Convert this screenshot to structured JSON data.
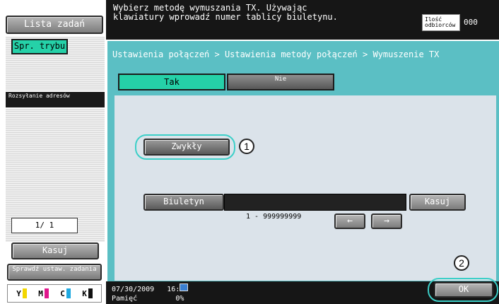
{
  "sidebar": {
    "job_list_label": "Lista zadań",
    "check_mode_label": "Spr. trybu",
    "address_broadcast_label": "Rozsyłanie adresów",
    "page_indicator": "1/ 1",
    "delete_label": "Kasuj",
    "check_job_settings_label": "Sprawdź ustaw. zadania",
    "toner": [
      {
        "letter": "Y",
        "color": "#f2d600"
      },
      {
        "letter": "M",
        "color": "#e0168c"
      },
      {
        "letter": "C",
        "color": "#1ea8e0"
      },
      {
        "letter": "K",
        "color": "#111111"
      }
    ]
  },
  "header": {
    "message_line1": "Wybierz metodę wymuszania TX. Używając",
    "message_line2": "klawiatury wprowadź numer tablicy biuletynu.",
    "recipient_count_label": "Ilość odbiorców",
    "recipient_count_value": "000"
  },
  "panel": {
    "breadcrumb": "Ustawienia połączeń > Ustawienia metody połączeń > Wymuszenie TX",
    "tab_yes": "Tak",
    "tab_no": "Nie",
    "normal_button": "Zwykły",
    "bulletin_button": "Biuletyn",
    "bulletin_value": "",
    "bulletin_range": "1 - 999999999",
    "clear_button": "Kasuj",
    "left_arrow_icon": "←",
    "right_arrow_icon": "→",
    "ok_button": "OK",
    "callout_1": "1",
    "callout_2": "2"
  },
  "footer": {
    "date": "07/30/2009",
    "time": "16:44",
    "memory_label": "Pamięć",
    "memory_value": "0%"
  },
  "colors": {
    "accent_teal": "#5bbfc4",
    "selected_green": "#25d1a8",
    "highlight_cyan": "#3ccfc8"
  }
}
